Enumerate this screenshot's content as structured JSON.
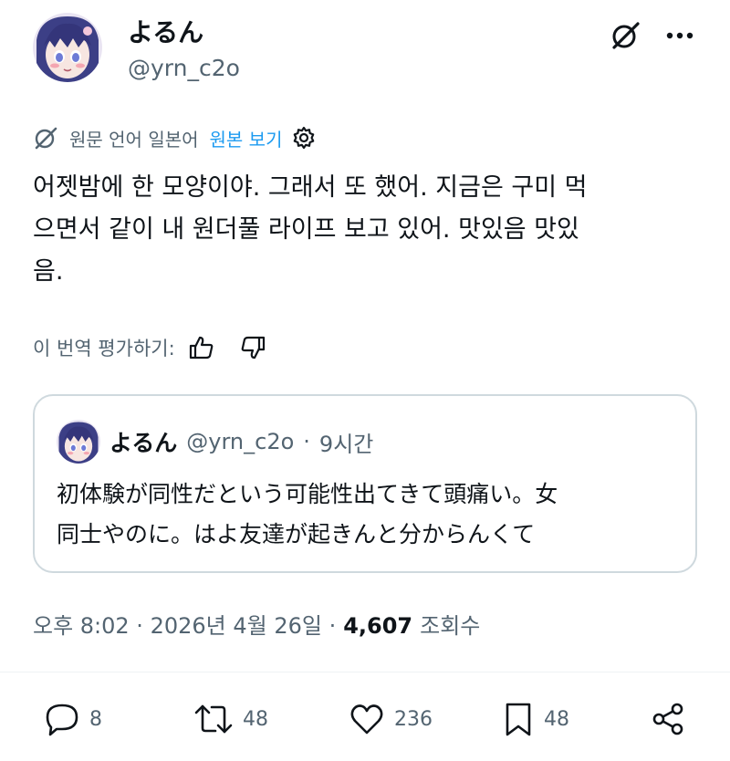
{
  "author": {
    "display_name": "よるん",
    "handle": "@yrn_c2o"
  },
  "header_icons": [
    "grok-icon",
    "more-icon"
  ],
  "translation": {
    "info": "원문 언어 일본어",
    "show_original": "원본 보기"
  },
  "tweet": {
    "lines": [
      "어젯밤에 한 모양이야. 그래서 또 했어. 지금은 구미 먹",
      "으면서 같이 내 원더풀 라이프 보고 있어. 맛있음 맛있",
      "음."
    ]
  },
  "rate": {
    "label": "이 번역 평가하기:"
  },
  "quote": {
    "display_name": "よるん",
    "handle": "@yrn_c2o",
    "separator": "·",
    "time": "9시간",
    "lines": [
      "初体験が同性だという可能性出てきて頭痛い。女",
      "同士やのに。はよ友達が起きんと分からんくて"
    ]
  },
  "meta": {
    "timestamp": "오후 8:02 · 2026년 4월 26일 ·",
    "views_count": "4,607",
    "views_label": "조회수"
  },
  "actions": {
    "replies": "8",
    "retweets": "48",
    "likes": "236",
    "bookmarks": "48"
  },
  "colors": {
    "accent": "#1d9bf0",
    "secondary_text": "#536471",
    "border": "#cfd9de"
  }
}
